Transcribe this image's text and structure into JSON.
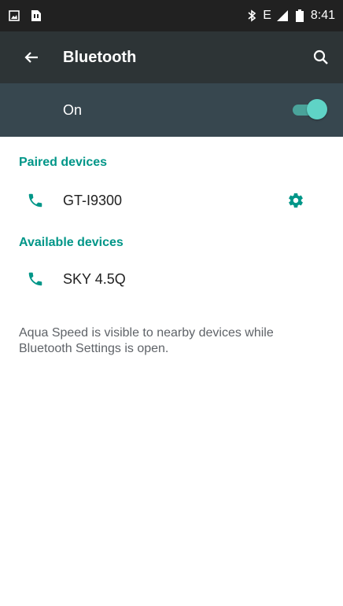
{
  "status_bar": {
    "time": "8:41",
    "network": "E"
  },
  "app_bar": {
    "title": "Bluetooth"
  },
  "toggle": {
    "label": "On",
    "state": "on"
  },
  "paired": {
    "header": "Paired devices",
    "devices": [
      {
        "name": "GT-I9300"
      }
    ]
  },
  "available": {
    "header": "Available devices",
    "devices": [
      {
        "name": "SKY 4.5Q"
      }
    ]
  },
  "note": "Aqua Speed is visible to nearby devices while Bluetooth Settings is open.",
  "colors": {
    "accent": "#009688",
    "toolbar": "#2d3436",
    "toggle_bar": "#37474f",
    "status_bar": "#212121"
  }
}
